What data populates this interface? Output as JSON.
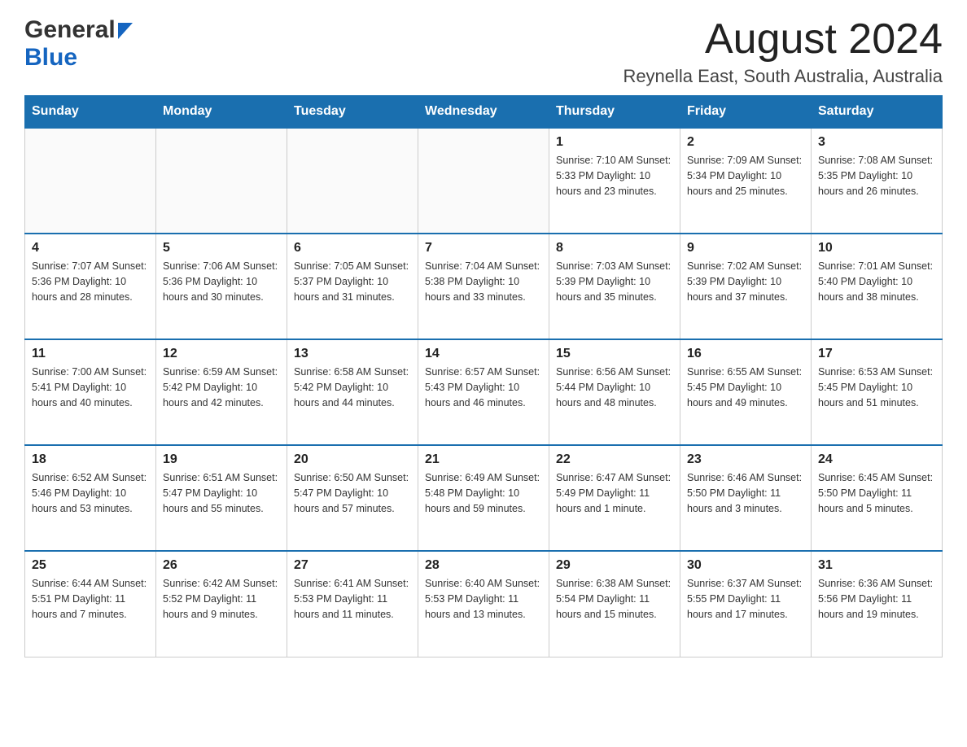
{
  "header": {
    "logo_general": "General",
    "logo_blue": "Blue",
    "month_title": "August 2024",
    "location": "Reynella East, South Australia, Australia"
  },
  "days_of_week": [
    "Sunday",
    "Monday",
    "Tuesday",
    "Wednesday",
    "Thursday",
    "Friday",
    "Saturday"
  ],
  "weeks": [
    [
      {
        "day": "",
        "info": ""
      },
      {
        "day": "",
        "info": ""
      },
      {
        "day": "",
        "info": ""
      },
      {
        "day": "",
        "info": ""
      },
      {
        "day": "1",
        "info": "Sunrise: 7:10 AM\nSunset: 5:33 PM\nDaylight: 10 hours and 23 minutes."
      },
      {
        "day": "2",
        "info": "Sunrise: 7:09 AM\nSunset: 5:34 PM\nDaylight: 10 hours and 25 minutes."
      },
      {
        "day": "3",
        "info": "Sunrise: 7:08 AM\nSunset: 5:35 PM\nDaylight: 10 hours and 26 minutes."
      }
    ],
    [
      {
        "day": "4",
        "info": "Sunrise: 7:07 AM\nSunset: 5:36 PM\nDaylight: 10 hours and 28 minutes."
      },
      {
        "day": "5",
        "info": "Sunrise: 7:06 AM\nSunset: 5:36 PM\nDaylight: 10 hours and 30 minutes."
      },
      {
        "day": "6",
        "info": "Sunrise: 7:05 AM\nSunset: 5:37 PM\nDaylight: 10 hours and 31 minutes."
      },
      {
        "day": "7",
        "info": "Sunrise: 7:04 AM\nSunset: 5:38 PM\nDaylight: 10 hours and 33 minutes."
      },
      {
        "day": "8",
        "info": "Sunrise: 7:03 AM\nSunset: 5:39 PM\nDaylight: 10 hours and 35 minutes."
      },
      {
        "day": "9",
        "info": "Sunrise: 7:02 AM\nSunset: 5:39 PM\nDaylight: 10 hours and 37 minutes."
      },
      {
        "day": "10",
        "info": "Sunrise: 7:01 AM\nSunset: 5:40 PM\nDaylight: 10 hours and 38 minutes."
      }
    ],
    [
      {
        "day": "11",
        "info": "Sunrise: 7:00 AM\nSunset: 5:41 PM\nDaylight: 10 hours and 40 minutes."
      },
      {
        "day": "12",
        "info": "Sunrise: 6:59 AM\nSunset: 5:42 PM\nDaylight: 10 hours and 42 minutes."
      },
      {
        "day": "13",
        "info": "Sunrise: 6:58 AM\nSunset: 5:42 PM\nDaylight: 10 hours and 44 minutes."
      },
      {
        "day": "14",
        "info": "Sunrise: 6:57 AM\nSunset: 5:43 PM\nDaylight: 10 hours and 46 minutes."
      },
      {
        "day": "15",
        "info": "Sunrise: 6:56 AM\nSunset: 5:44 PM\nDaylight: 10 hours and 48 minutes."
      },
      {
        "day": "16",
        "info": "Sunrise: 6:55 AM\nSunset: 5:45 PM\nDaylight: 10 hours and 49 minutes."
      },
      {
        "day": "17",
        "info": "Sunrise: 6:53 AM\nSunset: 5:45 PM\nDaylight: 10 hours and 51 minutes."
      }
    ],
    [
      {
        "day": "18",
        "info": "Sunrise: 6:52 AM\nSunset: 5:46 PM\nDaylight: 10 hours and 53 minutes."
      },
      {
        "day": "19",
        "info": "Sunrise: 6:51 AM\nSunset: 5:47 PM\nDaylight: 10 hours and 55 minutes."
      },
      {
        "day": "20",
        "info": "Sunrise: 6:50 AM\nSunset: 5:47 PM\nDaylight: 10 hours and 57 minutes."
      },
      {
        "day": "21",
        "info": "Sunrise: 6:49 AM\nSunset: 5:48 PM\nDaylight: 10 hours and 59 minutes."
      },
      {
        "day": "22",
        "info": "Sunrise: 6:47 AM\nSunset: 5:49 PM\nDaylight: 11 hours and 1 minute."
      },
      {
        "day": "23",
        "info": "Sunrise: 6:46 AM\nSunset: 5:50 PM\nDaylight: 11 hours and 3 minutes."
      },
      {
        "day": "24",
        "info": "Sunrise: 6:45 AM\nSunset: 5:50 PM\nDaylight: 11 hours and 5 minutes."
      }
    ],
    [
      {
        "day": "25",
        "info": "Sunrise: 6:44 AM\nSunset: 5:51 PM\nDaylight: 11 hours and 7 minutes."
      },
      {
        "day": "26",
        "info": "Sunrise: 6:42 AM\nSunset: 5:52 PM\nDaylight: 11 hours and 9 minutes."
      },
      {
        "day": "27",
        "info": "Sunrise: 6:41 AM\nSunset: 5:53 PM\nDaylight: 11 hours and 11 minutes."
      },
      {
        "day": "28",
        "info": "Sunrise: 6:40 AM\nSunset: 5:53 PM\nDaylight: 11 hours and 13 minutes."
      },
      {
        "day": "29",
        "info": "Sunrise: 6:38 AM\nSunset: 5:54 PM\nDaylight: 11 hours and 15 minutes."
      },
      {
        "day": "30",
        "info": "Sunrise: 6:37 AM\nSunset: 5:55 PM\nDaylight: 11 hours and 17 minutes."
      },
      {
        "day": "31",
        "info": "Sunrise: 6:36 AM\nSunset: 5:56 PM\nDaylight: 11 hours and 19 minutes."
      }
    ]
  ]
}
